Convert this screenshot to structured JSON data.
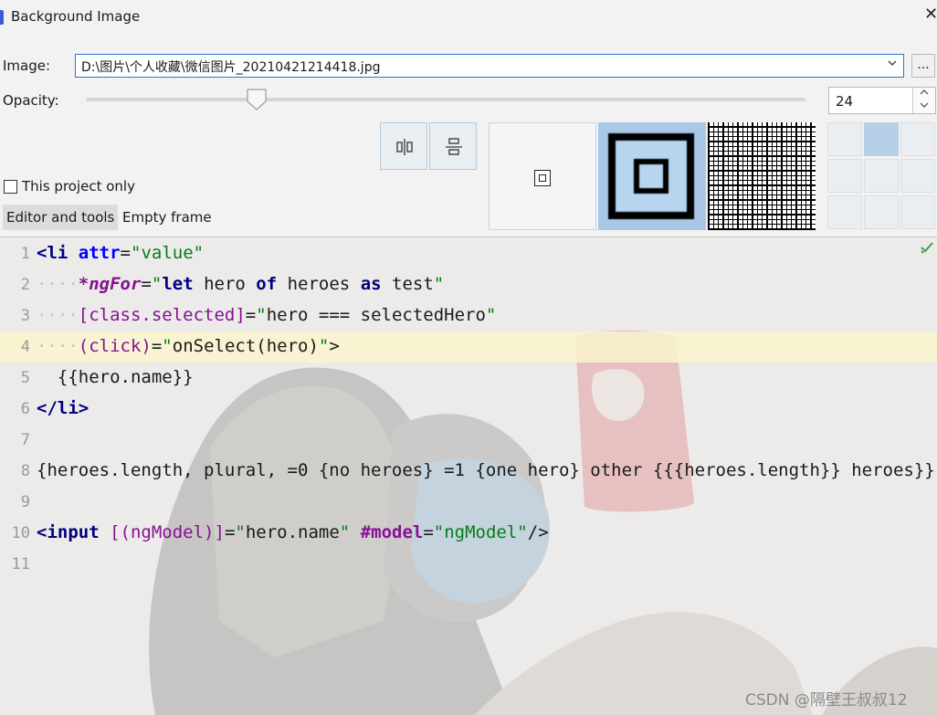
{
  "window": {
    "title": "Background Image",
    "close_label": "✕"
  },
  "image": {
    "label": "Image:",
    "path": "D:\\图片\\个人收藏\\微信图片_20210421214418.jpg",
    "browse_label": "..."
  },
  "opacity": {
    "label": "Opacity:",
    "value": "24",
    "fraction": 0.24
  },
  "placement": {
    "options": [
      "center",
      "scale",
      "tile"
    ],
    "selected": "scale"
  },
  "anchor": {
    "selected_row": 0,
    "selected_col": 1
  },
  "scope": {
    "checkbox_label": "This project only",
    "checked": false
  },
  "tabs": [
    {
      "label": "Editor and tools",
      "active": true
    },
    {
      "label": "Empty frame",
      "active": false
    }
  ],
  "editor": {
    "line_numbers": [
      "1",
      "2",
      "3",
      "4",
      "5",
      "6",
      "7",
      "8",
      "9",
      "10",
      "11"
    ],
    "highlighted_line": 4
  },
  "watermark": "CSDN @隔壁王叔叔12",
  "colors": {
    "accent": "#2f74d0",
    "selected_cell": "#b7d0e8",
    "current_line": "#faf4cd"
  },
  "icons": [
    "close-icon",
    "chevron-down-icon",
    "slider-thumb-icon",
    "spin-up-icon",
    "spin-down-icon",
    "align-horizontal-center-icon",
    "align-vertical-center-icon",
    "checkmark-icon"
  ]
}
